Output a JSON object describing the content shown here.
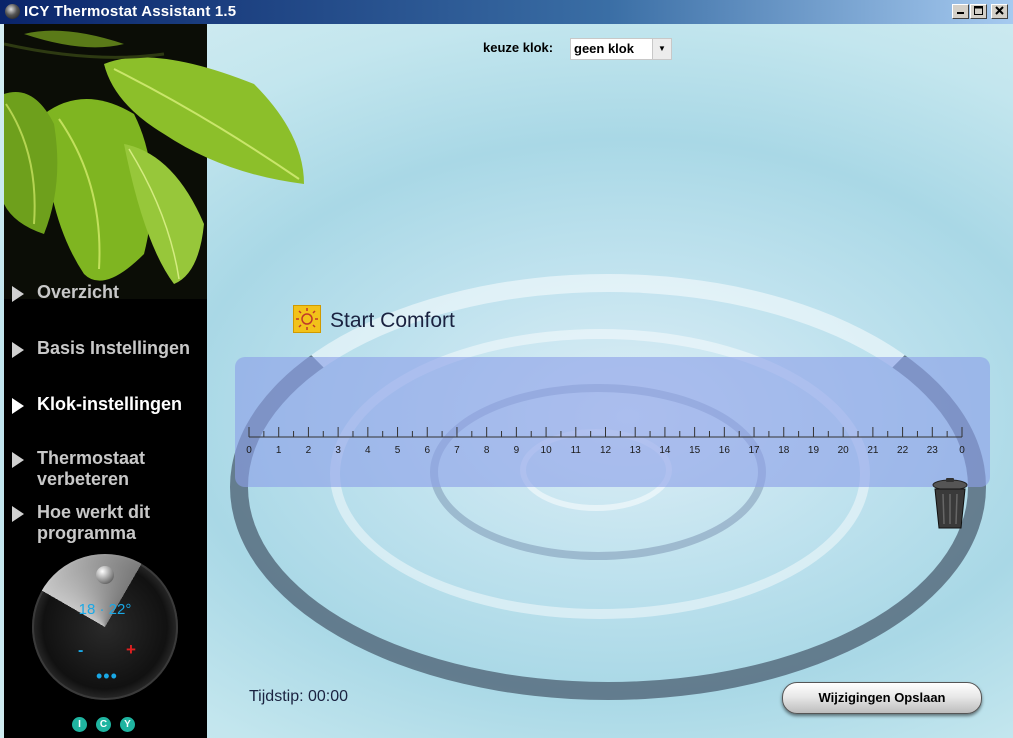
{
  "window": {
    "title": "ICY Thermostat Assistant 1.5",
    "minimize_icon": "minimize-icon",
    "maximize_icon": "maximize-icon",
    "close_icon": "close-icon"
  },
  "sidebar": {
    "items": [
      {
        "label": "Overzicht",
        "active": false
      },
      {
        "label": "Basis Instellingen",
        "active": false
      },
      {
        "label": "Klok-instellingen",
        "active": true
      },
      {
        "label": "Thermostaat verbeteren",
        "active": false
      },
      {
        "label": "Hoe werkt dit programma",
        "active": false
      }
    ],
    "knob": {
      "temps": "18 · 22°",
      "minus": "-",
      "plus": "+",
      "dots": "•••"
    },
    "logo_letters": [
      "I",
      "C",
      "Y"
    ]
  },
  "clock_select": {
    "label": "keuze klok:",
    "value": "geen klok"
  },
  "mode": {
    "label": "Start Comfort",
    "icon": "sun-icon"
  },
  "timeline": {
    "hour_labels": [
      "0",
      "1",
      "2",
      "3",
      "4",
      "5",
      "6",
      "7",
      "8",
      "9",
      "10",
      "11",
      "12",
      "13",
      "14",
      "15",
      "16",
      "17",
      "18",
      "19",
      "20",
      "21",
      "22",
      "23",
      "0"
    ]
  },
  "time_readout": {
    "label": "Tijdstip:",
    "value": "00:00"
  },
  "save_button": {
    "label": "Wijzigingen Opslaan"
  },
  "colors": {
    "title_bar": "#0a246a",
    "timeline_panel": "#8ca0e8",
    "knob_accent": "#19a8e6",
    "sun": "#f2c21a"
  }
}
